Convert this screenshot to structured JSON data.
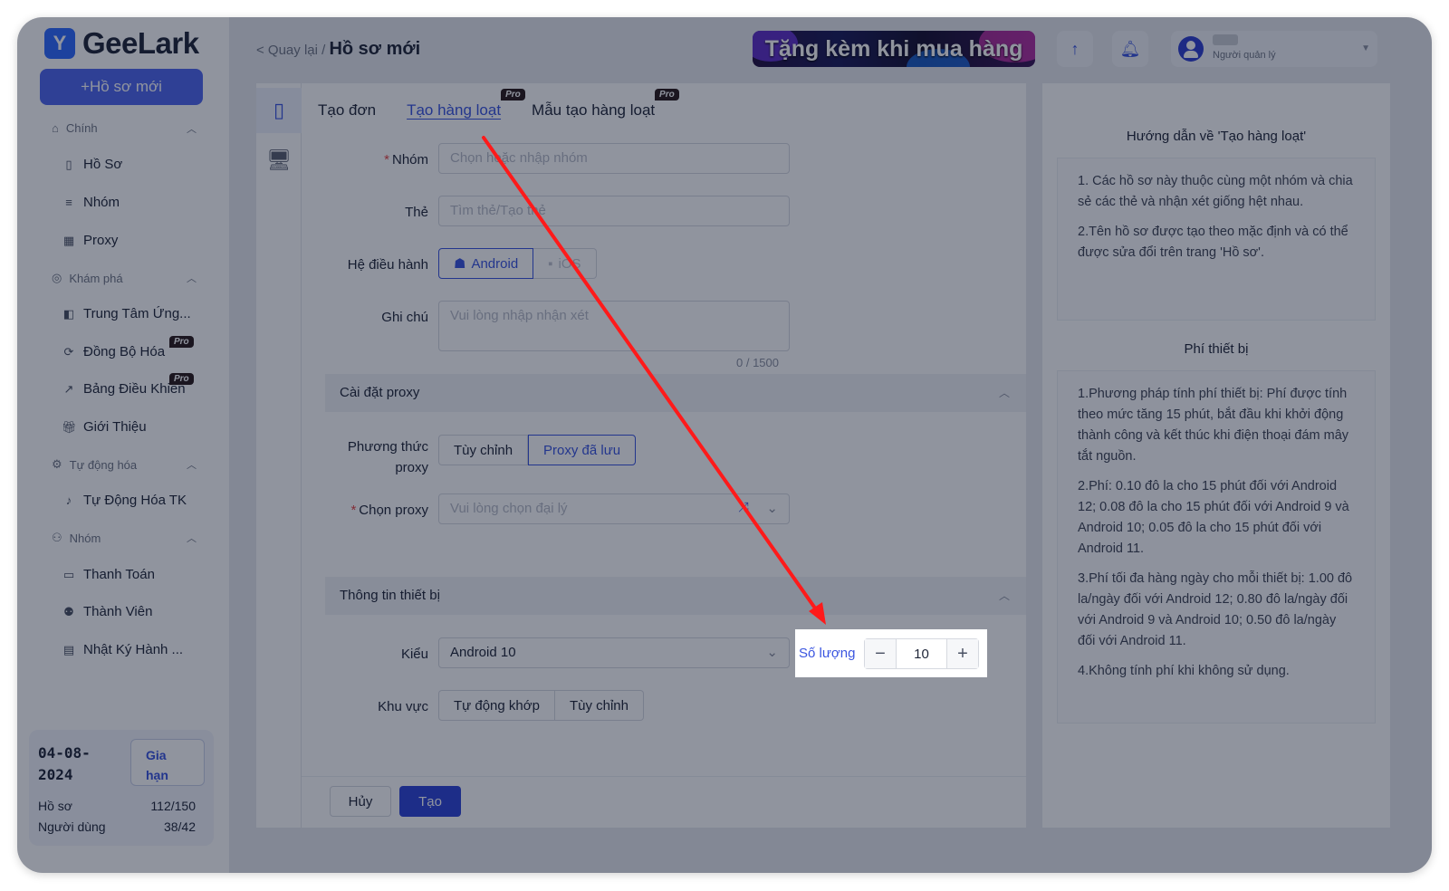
{
  "sidebar": {
    "logo": "GeeLark",
    "new_profile": "+Hồ sơ mới",
    "sections": [
      {
        "label": "Chính"
      },
      {
        "label": "Khám phá"
      },
      {
        "label": "Tự động hóa"
      },
      {
        "label": "Nhóm"
      }
    ],
    "items": [
      {
        "label": "Hồ Sơ"
      },
      {
        "label": "Nhóm"
      },
      {
        "label": "Proxy"
      },
      {
        "label": "Trung Tâm Ứng..."
      },
      {
        "label": "Đồng Bộ Hóa",
        "badge": "Pro"
      },
      {
        "label": "Bảng Điều Khiển",
        "badge": "Pro"
      },
      {
        "label": "Giới Thiệu"
      },
      {
        "label": "Tự Động Hóa TK"
      },
      {
        "label": "Thanh Toán"
      },
      {
        "label": "Thành Viên"
      },
      {
        "label": "Nhật Ký Hành ..."
      }
    ],
    "expiry": {
      "date": "04-08-2024",
      "renew": "Gia hạn",
      "profiles_label": "Hồ sơ",
      "profiles_value": "112/150",
      "users_label": "Người dùng",
      "users_value": "38/42"
    }
  },
  "header": {
    "back": "< Quay lại /",
    "title": "Hồ sơ mới",
    "banner": "Tặng kèm khi mua hàng",
    "user_role": "Người quản lý"
  },
  "tabs": [
    {
      "label": "Tạo đơn"
    },
    {
      "label": "Tạo hàng loạt",
      "badge": "Pro",
      "active": true
    },
    {
      "label": "Mẫu tạo hàng loạt",
      "badge": "Pro"
    }
  ],
  "form": {
    "group_label": "Nhóm",
    "group_placeholder": "Chọn hoặc nhập nhóm",
    "tag_label": "Thẻ",
    "tag_placeholder": "Tìm thẻ/Tạo thẻ",
    "os_label": "Hệ điều hành",
    "os_options": [
      "Android",
      "iOS"
    ],
    "note_label": "Ghi chú",
    "note_placeholder": "Vui lòng nhập nhận xét",
    "note_counter": "0 / 1500",
    "proxy_section": "Cài đặt proxy",
    "proxy_method_label": "Phương thức proxy",
    "proxy_method_options": [
      "Tùy chỉnh",
      "Proxy đã lưu"
    ],
    "proxy_select_label": "Chọn proxy",
    "proxy_select_placeholder": "Vui lòng chọn đại lý",
    "device_section": "Thông tin thiết bị",
    "type_label": "Kiểu",
    "type_value": "Android 10",
    "quantity_label": "Số lượng",
    "quantity_value": "10",
    "region_label": "Khu vực",
    "region_options": [
      "Tự động khớp",
      "Tùy chỉnh"
    ],
    "cancel": "Hủy",
    "create": "Tạo"
  },
  "guide": {
    "title1": "Hướng dẫn về 'Tạo hàng loạt'",
    "p1": "1. Các hồ sơ này thuộc cùng một nhóm và chia sẻ các thẻ và nhận xét giống hệt nhau.",
    "p2": "2.Tên hồ sơ được tạo theo mặc định và có thể được sửa đổi trên trang 'Hồ sơ'.",
    "title2": "Phí thiết bị",
    "f1": "1.Phương pháp tính phí thiết bị: Phí được tính theo mức tăng 15 phút, bắt đầu khi khởi động thành công và kết thúc khi điện thoại đám mây tắt nguồn.",
    "f2": "2.Phí: 0.10 đô la cho 15 phút đối với Android 12; 0.08 đô la cho 15 phút đối với Android 9 và Android 10; 0.05 đô la cho 15 phút đối với Android 11.",
    "f3": "3.Phí tối đa hàng ngày cho mỗi thiết bị: 1.00 đô la/ngày đối với Android 12; 0.80 đô la/ngày đối với Android 9 và Android 10; 0.50 đô la/ngày đối với Android 11.",
    "f4": "4.Không tính phí khi không sử dụng."
  },
  "colors": {
    "accent": "#3a55e0",
    "arrow": "#ff1a1a",
    "overlay": "rgba(8,18,40,0.45)"
  }
}
